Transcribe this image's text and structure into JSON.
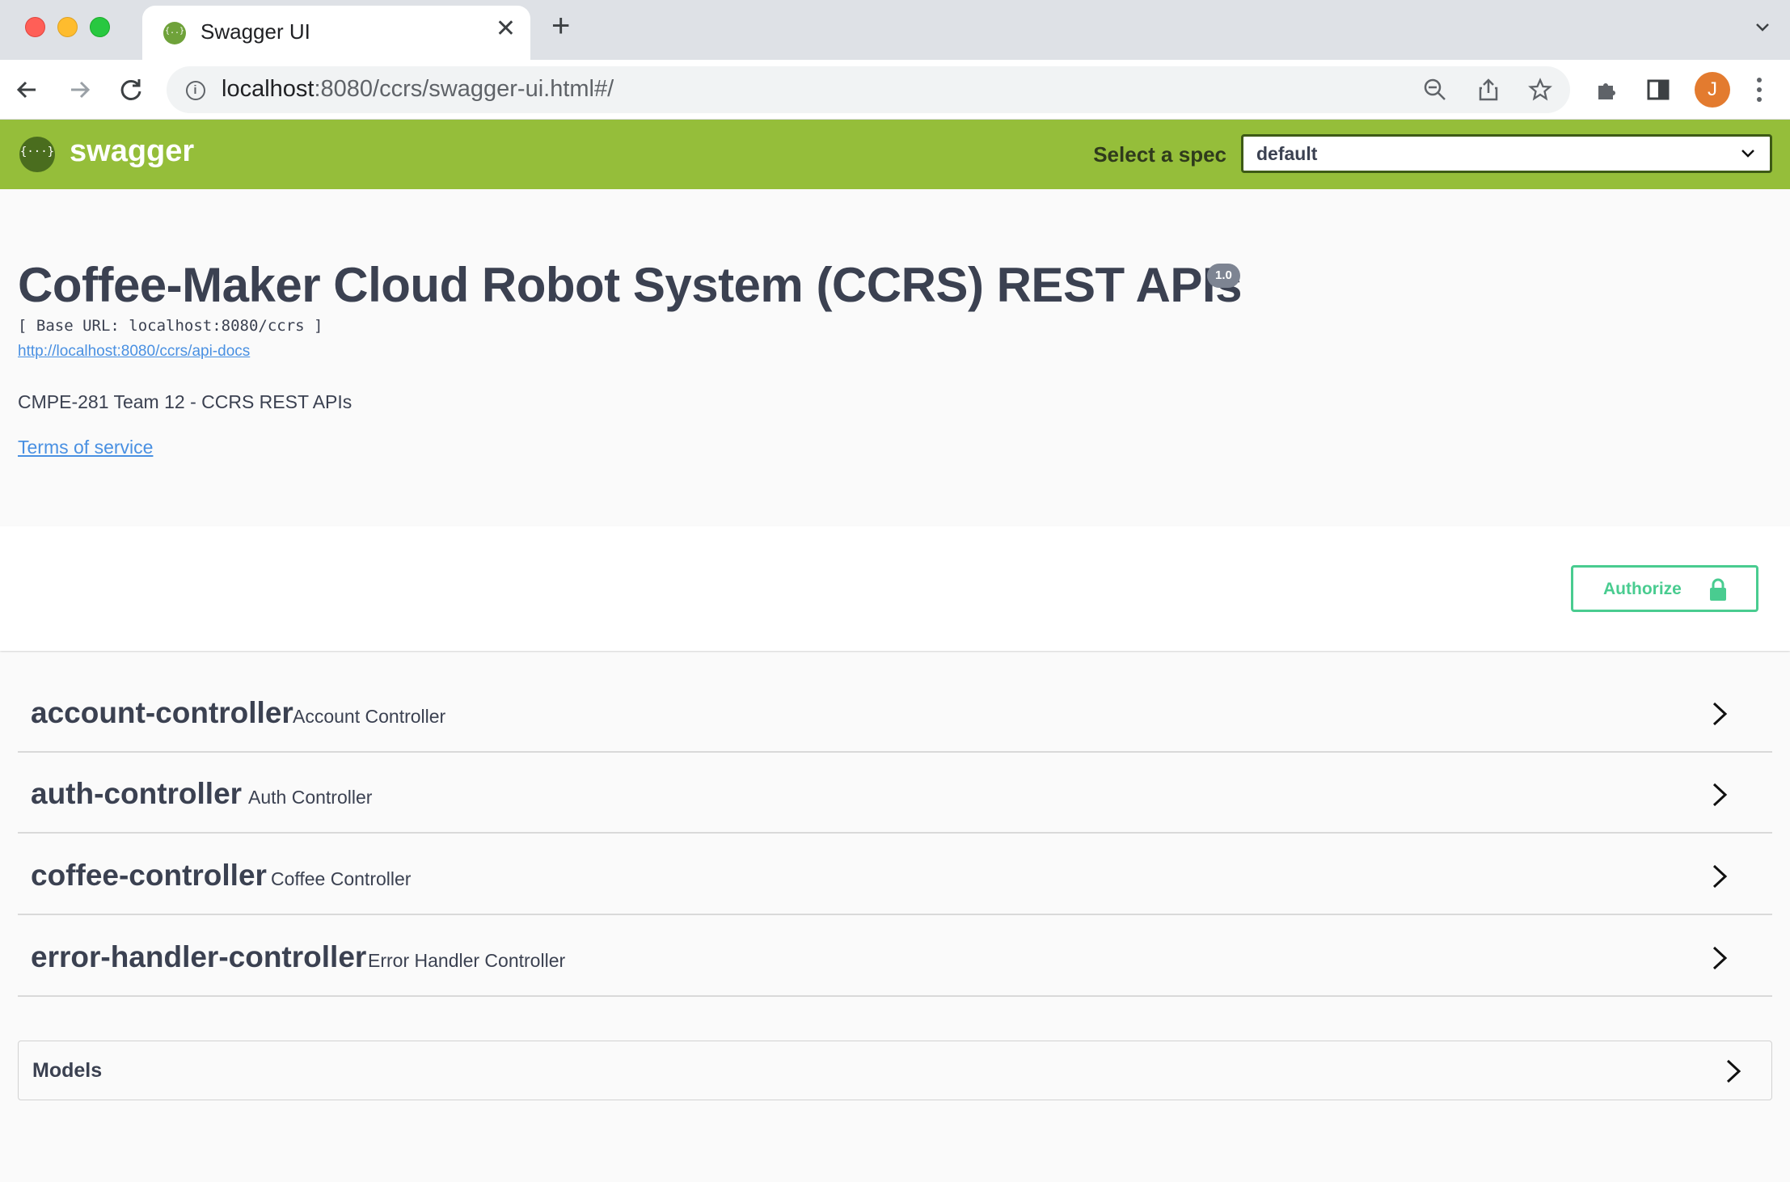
{
  "browser": {
    "tab_title": "Swagger UI",
    "url_host": "localhost",
    "url_rest": ":8080/ccrs/swagger-ui.html#/",
    "profile_initial": "J"
  },
  "topbar": {
    "logo_text": "swagger",
    "spec_label": "Select a spec",
    "spec_value": "default"
  },
  "info": {
    "title": "Coffee-Maker Cloud Robot System (CCRS) REST APIs",
    "version": "1.0",
    "base_url": "[ Base URL: localhost:8080/ccrs ]",
    "docs_link": "http://localhost:8080/ccrs/api-docs",
    "description": "CMPE-281 Team 12 - CCRS REST APIs",
    "terms": "Terms of service"
  },
  "authorize": {
    "label": "Authorize"
  },
  "tags": [
    {
      "name": "account-controller",
      "description": "Account Controller"
    },
    {
      "name": "auth-controller",
      "description": "Auth Controller"
    },
    {
      "name": "coffee-controller",
      "description": "Coffee Controller"
    },
    {
      "name": "error-handler-controller",
      "description": "Error Handler Controller"
    }
  ],
  "models": {
    "label": "Models"
  },
  "colors": {
    "swagger_green": "#95be3a",
    "authorize_green": "#49cc90",
    "link_blue": "#4990e2",
    "text": "#3b4151"
  }
}
